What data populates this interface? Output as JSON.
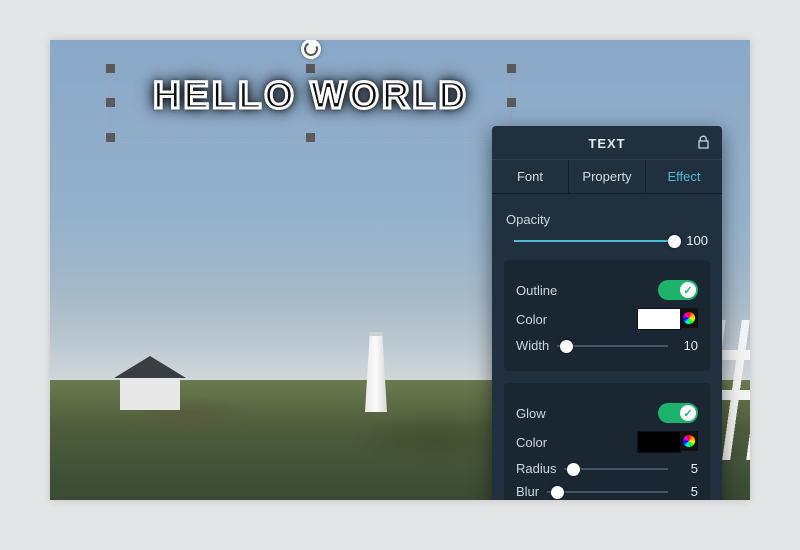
{
  "canvas": {
    "text_content": "HELLO WORLD"
  },
  "panel": {
    "title": "TEXT",
    "tabs": {
      "font": "Font",
      "property": "Property",
      "effect": "Effect",
      "active": "effect"
    },
    "opacity": {
      "label": "Opacity",
      "value": 100
    },
    "outline": {
      "label": "Outline",
      "enabled": true,
      "color_label": "Color",
      "color": "#ffffff",
      "width_label": "Width",
      "width": 10
    },
    "glow": {
      "label": "Glow",
      "enabled": true,
      "color_label": "Color",
      "color": "#000000",
      "radius_label": "Radius",
      "radius": 5,
      "blur_label": "Blur",
      "blur": 5
    }
  }
}
